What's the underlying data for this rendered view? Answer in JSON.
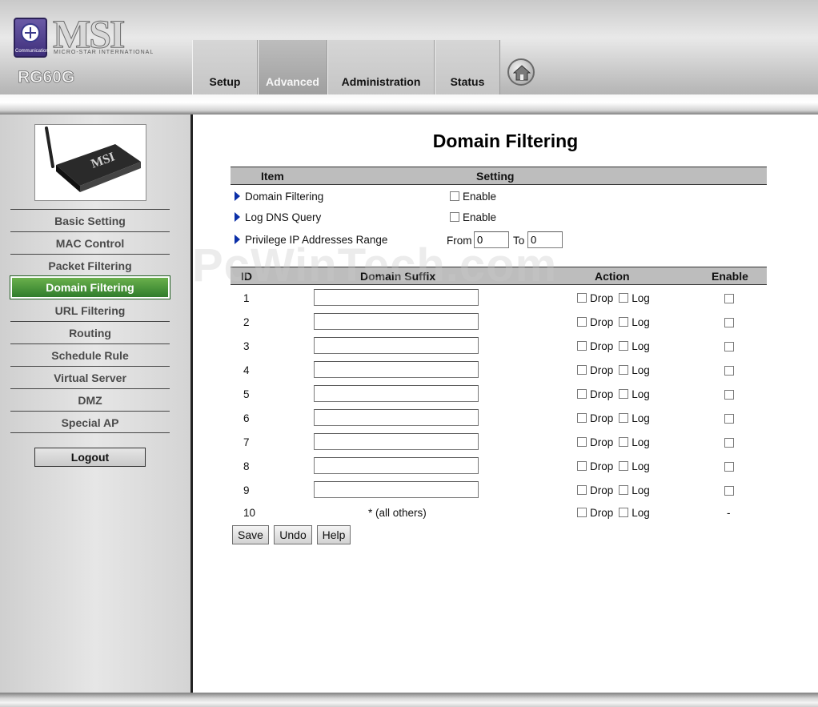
{
  "header": {
    "brand": "MSI",
    "brand_sub": "MICRO-STAR INTERNATIONAL",
    "badge_text": "Communication",
    "model": "RG60G",
    "tabs": [
      {
        "label": "Setup"
      },
      {
        "label": "Advanced"
      },
      {
        "label": "Administration"
      },
      {
        "label": "Status"
      }
    ],
    "home_icon": "home-icon"
  },
  "sidebar": {
    "items": [
      {
        "label": "Basic Setting"
      },
      {
        "label": "MAC Control"
      },
      {
        "label": "Packet Filtering"
      },
      {
        "label": "Domain Filtering"
      },
      {
        "label": "URL Filtering"
      },
      {
        "label": "Routing"
      },
      {
        "label": "Schedule Rule"
      },
      {
        "label": "Virtual Server"
      },
      {
        "label": "DMZ"
      },
      {
        "label": "Special AP"
      }
    ],
    "active_item": "Domain Filtering",
    "logout_label": "Logout"
  },
  "main": {
    "title": "Domain Filtering",
    "settings_header": {
      "item": "Item",
      "setting": "Setting"
    },
    "settings": {
      "domain_filtering": {
        "label": "Domain Filtering",
        "option": "Enable"
      },
      "log_dns": {
        "label": "Log DNS Query",
        "option": "Enable"
      },
      "privilege": {
        "label": "Privilege IP Addresses Range",
        "from_label": "From",
        "from_value": "0",
        "to_label": "To",
        "to_value": "0"
      }
    },
    "rules_header": {
      "id": "ID",
      "suffix": "Domain Suffix",
      "action": "Action",
      "enable": "Enable"
    },
    "action_labels": {
      "drop": "Drop",
      "log": "Log"
    },
    "rules": [
      {
        "id": "1",
        "suffix": ""
      },
      {
        "id": "2",
        "suffix": ""
      },
      {
        "id": "3",
        "suffix": ""
      },
      {
        "id": "4",
        "suffix": ""
      },
      {
        "id": "5",
        "suffix": ""
      },
      {
        "id": "6",
        "suffix": ""
      },
      {
        "id": "7",
        "suffix": ""
      },
      {
        "id": "8",
        "suffix": ""
      },
      {
        "id": "9",
        "suffix": ""
      }
    ],
    "last_rule": {
      "id": "10",
      "suffix_text": "* (all others)",
      "enable_text": "-"
    },
    "buttons": {
      "save": "Save",
      "undo": "Undo",
      "help": "Help"
    }
  },
  "watermark": "PcWinTech.com"
}
